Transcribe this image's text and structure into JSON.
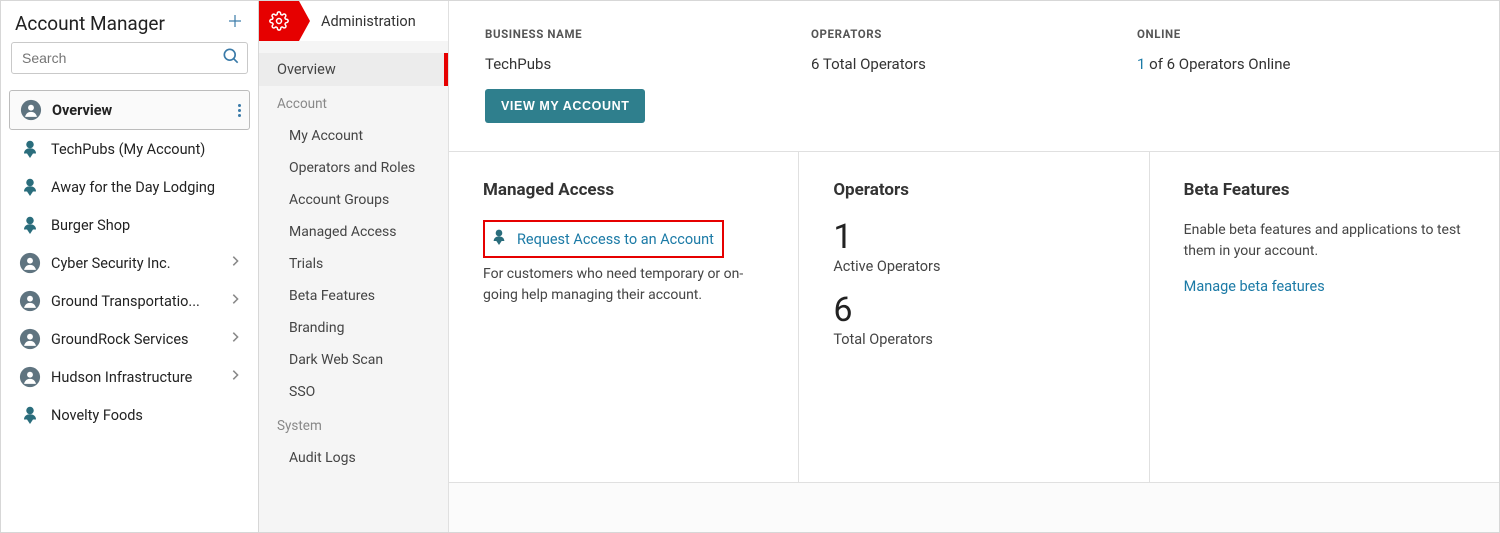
{
  "sidebar": {
    "title": "Account Manager",
    "search_placeholder": "Search",
    "items": [
      {
        "label": "Overview",
        "icon": "person-circle",
        "selected": true,
        "chevron": false,
        "kebab": true
      },
      {
        "label": "TechPubs (My Account)",
        "icon": "person-pin",
        "selected": false,
        "chevron": false
      },
      {
        "label": "Away for the Day Lodging",
        "icon": "person-pin",
        "selected": false,
        "chevron": false
      },
      {
        "label": "Burger Shop",
        "icon": "person-pin",
        "selected": false,
        "chevron": false
      },
      {
        "label": "Cyber Security Inc.",
        "icon": "person-circle",
        "selected": false,
        "chevron": true
      },
      {
        "label": "Ground Transportatio...",
        "icon": "person-circle",
        "selected": false,
        "chevron": true
      },
      {
        "label": "GroundRock Services",
        "icon": "person-circle",
        "selected": false,
        "chevron": true
      },
      {
        "label": "Hudson Infrastructure",
        "icon": "person-circle",
        "selected": false,
        "chevron": true
      },
      {
        "label": "Novelty Foods",
        "icon": "person-pin",
        "selected": false,
        "chevron": false
      }
    ]
  },
  "midnav": {
    "title": "Administration",
    "items": [
      {
        "type": "item",
        "label": "Overview",
        "active": true
      },
      {
        "type": "heading",
        "label": "Account"
      },
      {
        "type": "item",
        "label": "My Account"
      },
      {
        "type": "item",
        "label": "Operators and Roles"
      },
      {
        "type": "item",
        "label": "Account Groups"
      },
      {
        "type": "item",
        "label": "Managed Access"
      },
      {
        "type": "item",
        "label": "Trials"
      },
      {
        "type": "item",
        "label": "Beta Features"
      },
      {
        "type": "item",
        "label": "Branding"
      },
      {
        "type": "item",
        "label": "Dark Web Scan"
      },
      {
        "type": "item",
        "label": "SSO"
      },
      {
        "type": "heading",
        "label": "System"
      },
      {
        "type": "item",
        "label": "Audit Logs"
      }
    ]
  },
  "top": {
    "business_label": "BUSINESS NAME",
    "business_value": "TechPubs",
    "view_button": "VIEW MY ACCOUNT",
    "operators_label": "OPERATORS",
    "operators_value": "6 Total Operators",
    "online_label": "ONLINE",
    "online_num": "1",
    "online_rest": " of 6 Operators Online"
  },
  "cards": {
    "managed": {
      "title": "Managed Access",
      "link": "Request Access to an Account",
      "desc": "For customers who need temporary or on-going help managing their account."
    },
    "operators": {
      "title": "Operators",
      "active_num": "1",
      "active_label": "Active Operators",
      "total_num": "6",
      "total_label": "Total Operators"
    },
    "beta": {
      "title": "Beta Features",
      "desc": "Enable beta features and applications to test them in your account.",
      "link": "Manage beta features"
    }
  }
}
